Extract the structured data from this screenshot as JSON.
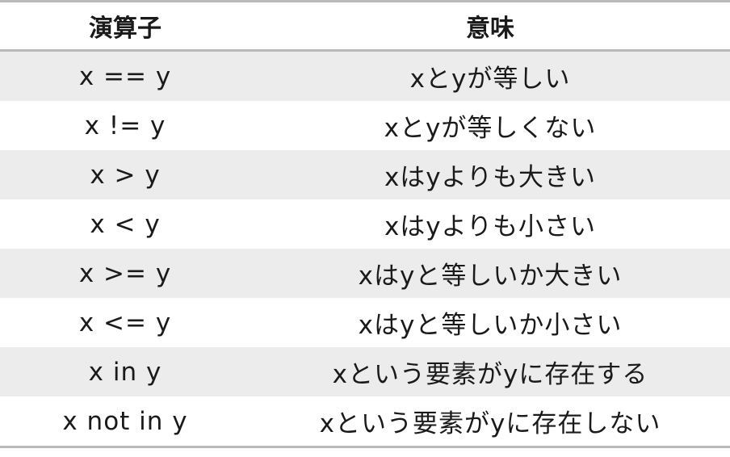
{
  "table": {
    "headers": [
      "演算子",
      "意味"
    ],
    "rows": [
      {
        "operator": "x == y",
        "meaning": "xとyが等しい"
      },
      {
        "operator": "x != y",
        "meaning": "xとyが等しくない"
      },
      {
        "operator": "x > y",
        "meaning": "xはyよりも大きい"
      },
      {
        "operator": "x < y",
        "meaning": "xはyよりも小さい"
      },
      {
        "operator": "x >= y",
        "meaning": "xはyと等しいか大きい"
      },
      {
        "operator": "x <= y",
        "meaning": "xはyと等しいか小さい"
      },
      {
        "operator": "x in y",
        "meaning": "xという要素がyに存在する"
      },
      {
        "operator": "x not in y",
        "meaning": "xという要素がyに存在しない"
      }
    ]
  },
  "colors": {
    "stripe": "#ececec",
    "rule": "#b9b9b9",
    "text": "#1a1a1a"
  }
}
